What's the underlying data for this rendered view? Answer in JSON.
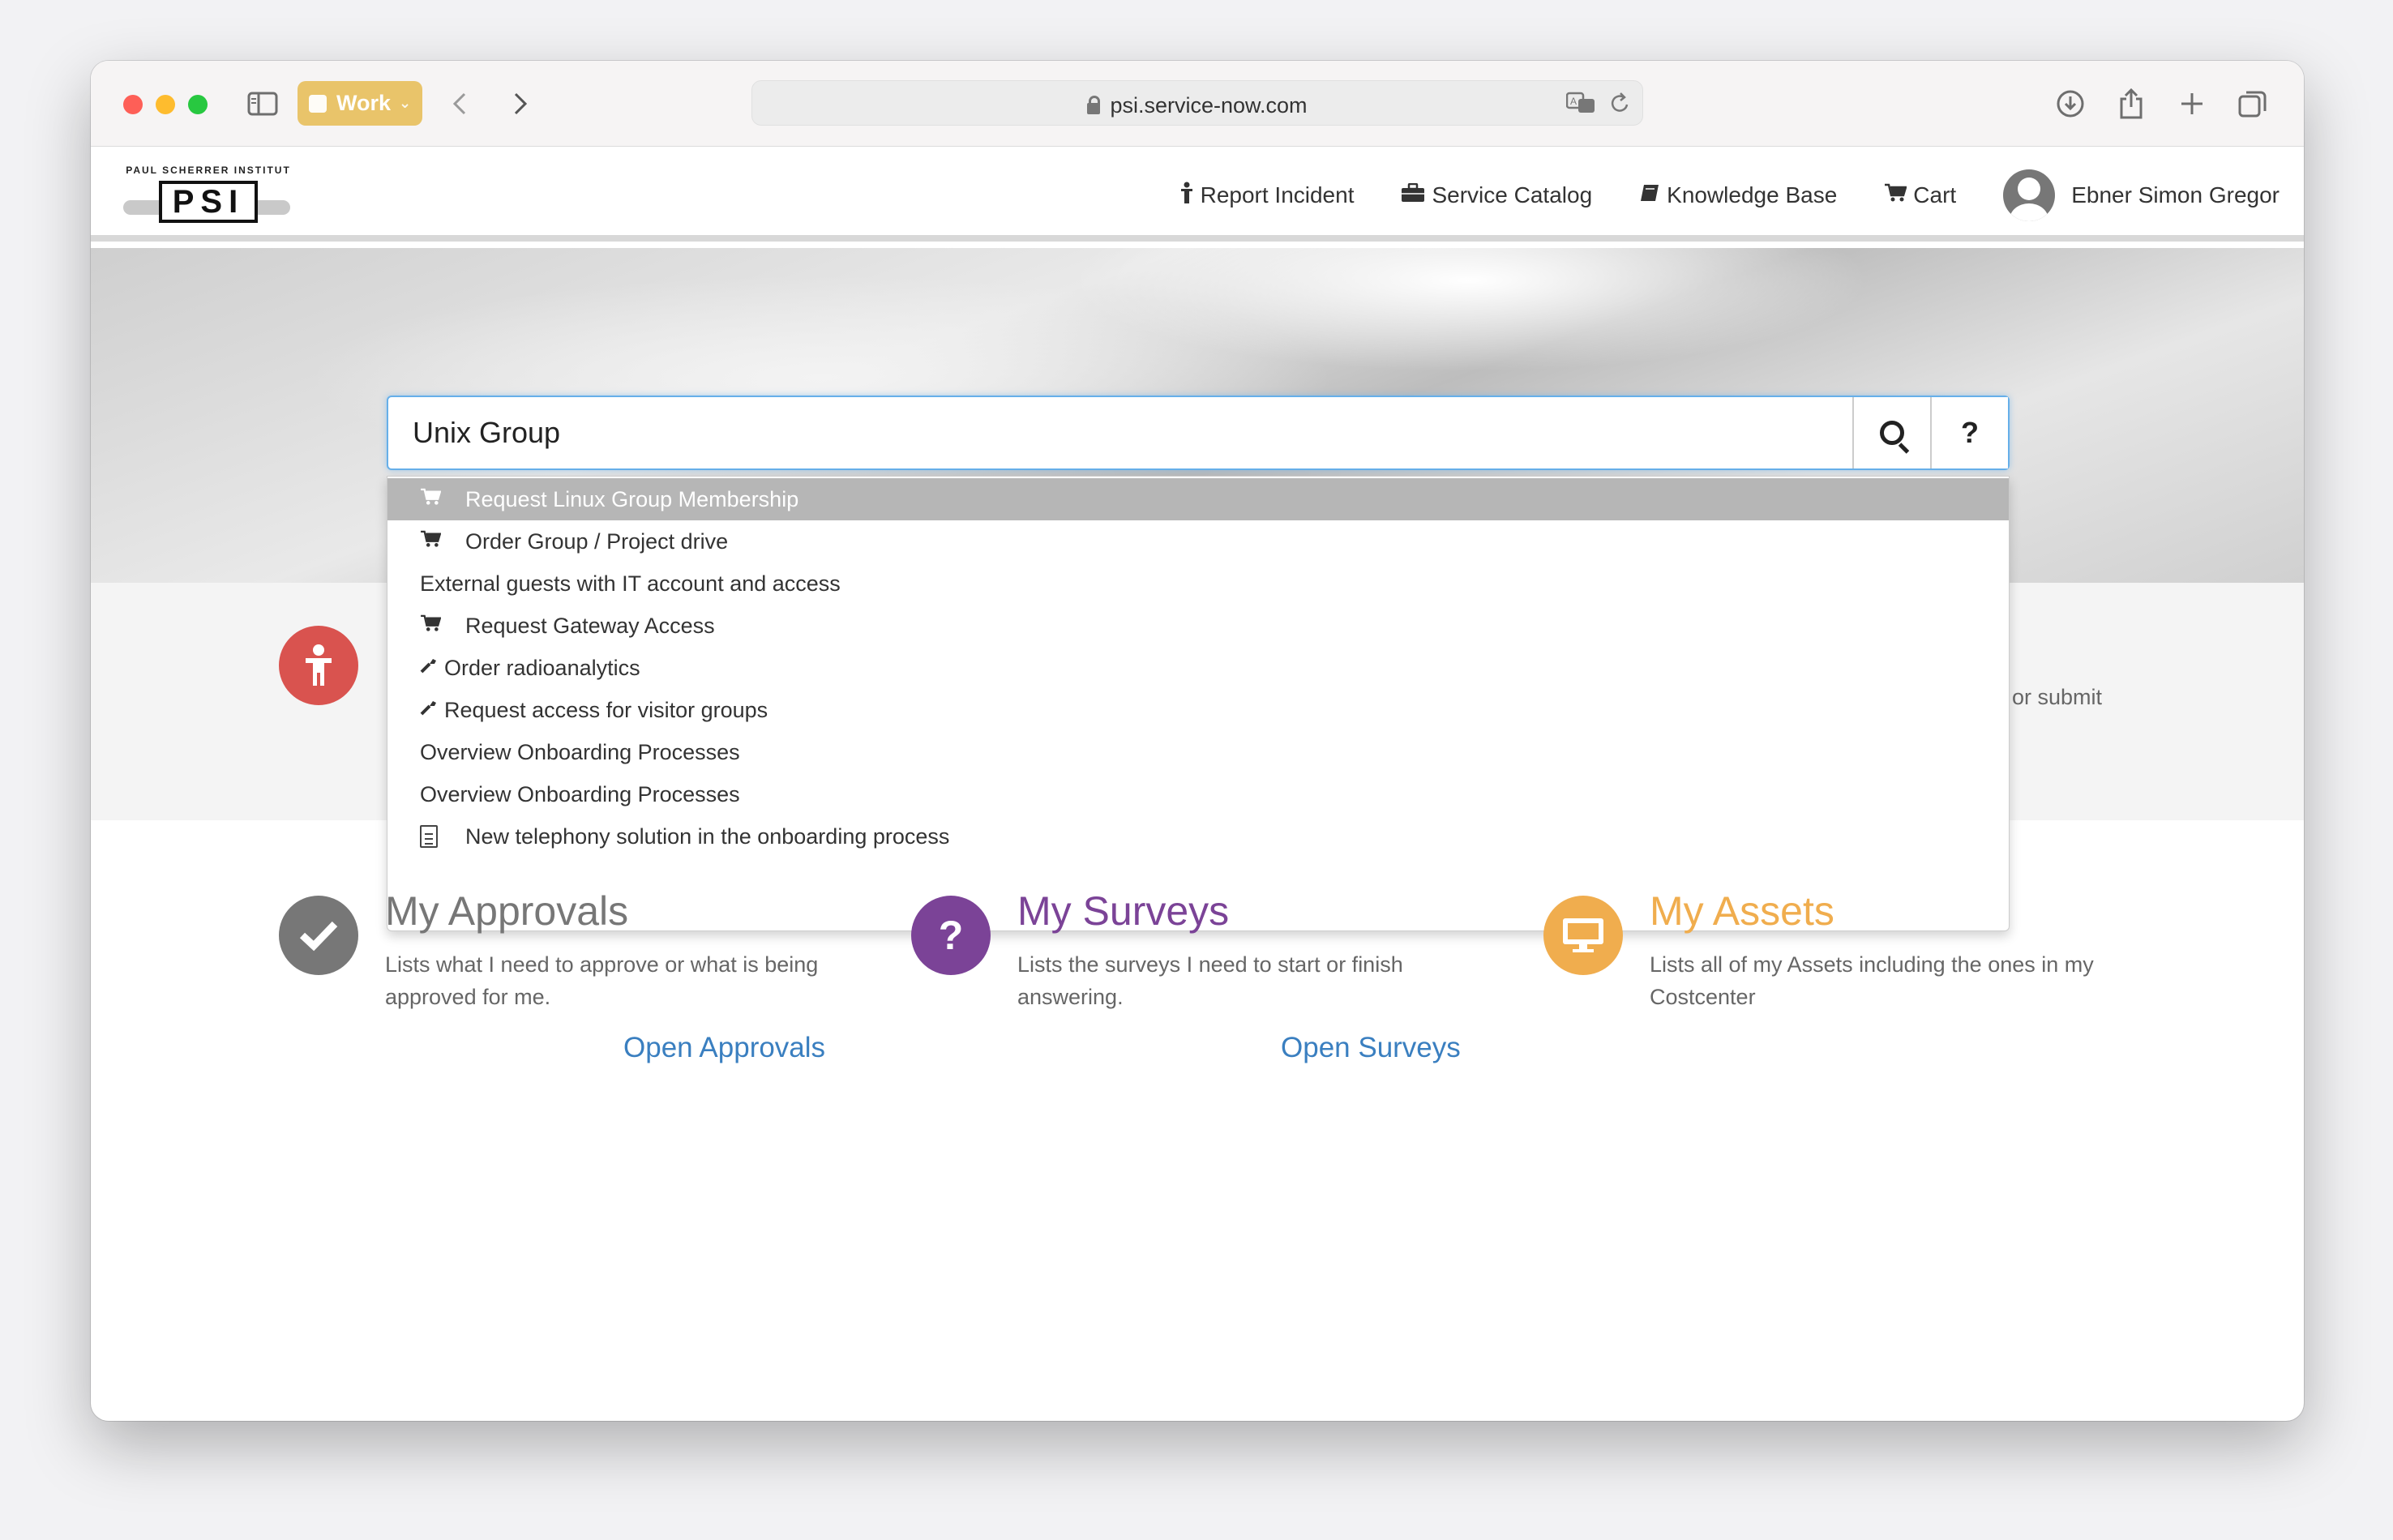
{
  "browser": {
    "profile_label": "Work",
    "url": "psi.service-now.com"
  },
  "header": {
    "logo_text": "PAUL SCHERRER INSTITUT",
    "logo_mark": "PSI",
    "nav": [
      {
        "label": "Report Incident",
        "icon": "person-icon"
      },
      {
        "label": "Service Catalog",
        "icon": "briefcase-icon"
      },
      {
        "label": "Knowledge Base",
        "icon": "book-icon"
      },
      {
        "label": "Cart",
        "icon": "cart-icon"
      }
    ],
    "user_name": "Ebner Simon Gregor"
  },
  "search": {
    "value": "Unix Group",
    "help_label": "?"
  },
  "suggestions": [
    {
      "label": "Request Linux Group Membership",
      "icon": "cart-icon"
    },
    {
      "label": "Order Group / Project drive",
      "icon": "cart-icon"
    },
    {
      "label": "External guests with IT account and access",
      "icon": ""
    },
    {
      "label": "Request Gateway Access",
      "icon": "cart-icon"
    },
    {
      "label": "Order radioanalytics",
      "icon": "wrench-icon"
    },
    {
      "label": "Request access for visitor groups",
      "icon": "wrench-icon"
    },
    {
      "label": "Overview Onboarding Processes",
      "icon": ""
    },
    {
      "label": "Overview Onboarding Processes",
      "icon": ""
    },
    {
      "label": "New telephony solution in the onboarding process",
      "icon": "document-icon"
    }
  ],
  "band": {
    "partial_text": "or submit"
  },
  "tiles": {
    "approvals": {
      "title": "My Approvals",
      "desc_line1": "Lists what I need to approve or what is being",
      "desc_line2": "approved for me.",
      "link": "Open Approvals",
      "color": "#777777"
    },
    "surveys": {
      "title": "My Surveys",
      "desc_line1": "Lists the surveys I need to start or finish",
      "desc_line2": "answering.",
      "link": "Open Surveys",
      "color": "#7b4397"
    },
    "assets": {
      "title": "My Assets",
      "desc_line1": "Lists all of my Assets including the ones in my",
      "desc_line2": "Costcenter",
      "color": "#f0ad4e"
    }
  }
}
